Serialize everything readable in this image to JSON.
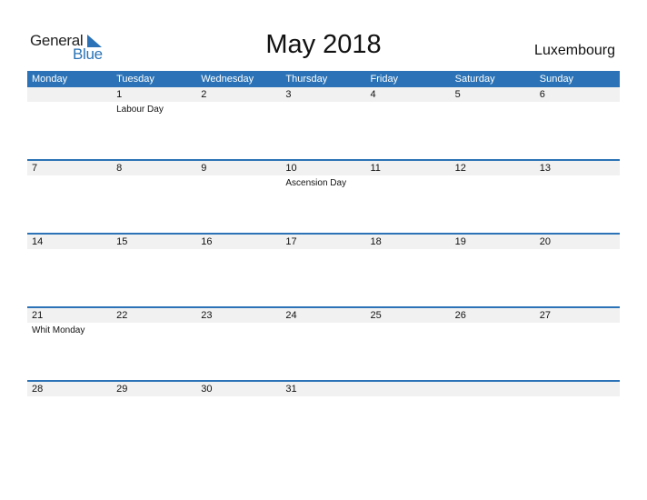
{
  "logo": {
    "line1": "General",
    "line2": "Blue"
  },
  "title": "May 2018",
  "country": "Luxembourg",
  "colors": {
    "accent": "#2b73b6",
    "day_row_bg": "#f1f1f1"
  },
  "weekdays": [
    "Monday",
    "Tuesday",
    "Wednesday",
    "Thursday",
    "Friday",
    "Saturday",
    "Sunday"
  ],
  "weeks": [
    {
      "days": [
        {
          "num": "",
          "holiday": ""
        },
        {
          "num": "1",
          "holiday": "Labour Day"
        },
        {
          "num": "2",
          "holiday": ""
        },
        {
          "num": "3",
          "holiday": ""
        },
        {
          "num": "4",
          "holiday": ""
        },
        {
          "num": "5",
          "holiday": ""
        },
        {
          "num": "6",
          "holiday": ""
        }
      ]
    },
    {
      "days": [
        {
          "num": "7",
          "holiday": ""
        },
        {
          "num": "8",
          "holiday": ""
        },
        {
          "num": "9",
          "holiday": ""
        },
        {
          "num": "10",
          "holiday": "Ascension Day"
        },
        {
          "num": "11",
          "holiday": ""
        },
        {
          "num": "12",
          "holiday": ""
        },
        {
          "num": "13",
          "holiday": ""
        }
      ]
    },
    {
      "days": [
        {
          "num": "14",
          "holiday": ""
        },
        {
          "num": "15",
          "holiday": ""
        },
        {
          "num": "16",
          "holiday": ""
        },
        {
          "num": "17",
          "holiday": ""
        },
        {
          "num": "18",
          "holiday": ""
        },
        {
          "num": "19",
          "holiday": ""
        },
        {
          "num": "20",
          "holiday": ""
        }
      ]
    },
    {
      "days": [
        {
          "num": "21",
          "holiday": "Whit Monday"
        },
        {
          "num": "22",
          "holiday": ""
        },
        {
          "num": "23",
          "holiday": ""
        },
        {
          "num": "24",
          "holiday": ""
        },
        {
          "num": "25",
          "holiday": ""
        },
        {
          "num": "26",
          "holiday": ""
        },
        {
          "num": "27",
          "holiday": ""
        }
      ]
    },
    {
      "days": [
        {
          "num": "28",
          "holiday": ""
        },
        {
          "num": "29",
          "holiday": ""
        },
        {
          "num": "30",
          "holiday": ""
        },
        {
          "num": "31",
          "holiday": ""
        }
      ]
    }
  ]
}
